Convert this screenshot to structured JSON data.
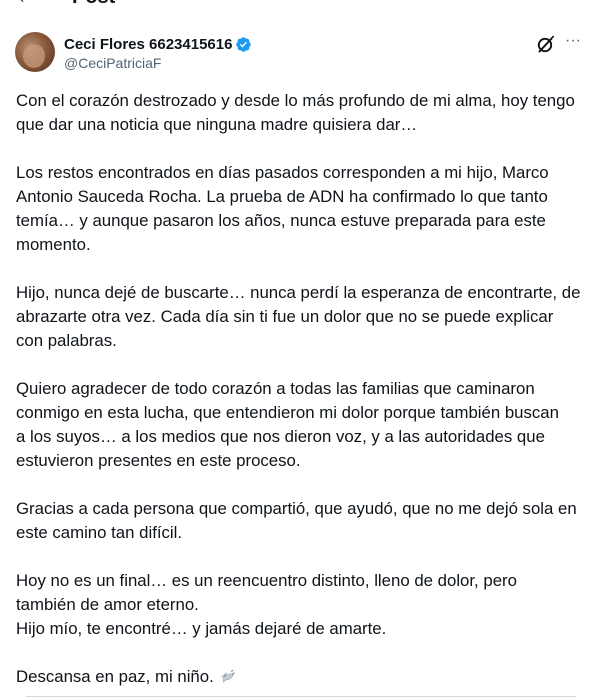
{
  "topbar": {
    "back_glyph": "←",
    "title": "Post"
  },
  "author": {
    "display_name": "Ceci Flores 6623415616",
    "handle": "@CeciPatriciaF",
    "verified": true,
    "badge_color": "#1d9bf0"
  },
  "actions": {
    "grok_icon": "grok-icon",
    "more_icon": "more-icon",
    "more_glyph": "···"
  },
  "tweet": {
    "paragraphs": [
      {
        "lines": [
          "Con el corazón destrozado y desde lo más profundo de mi alma, hoy tengo",
          "que dar una noticia que ninguna madre quisiera dar…"
        ]
      },
      {
        "lines": [
          "Los restos encontrados en días pasados corresponden a mi hijo, Marco",
          "Antonio Sauceda Rocha. La prueba de ADN ha confirmado lo que tanto",
          "temía… y aunque pasaron los años, nunca estuve preparada para este",
          "momento."
        ]
      },
      {
        "lines": [
          "Hijo, nunca dejé de buscarte… nunca perdí la esperanza de encontrarte, de",
          "abrazarte otra vez. Cada día sin ti fue un dolor que no se puede explicar",
          "con palabras."
        ]
      },
      {
        "lines": [
          "Quiero agradecer de todo corazón a todas las familias que caminaron",
          "conmigo en esta lucha, que entendieron mi dolor porque también buscan",
          "a los suyos… a los medios que nos dieron voz, y a las autoridades que",
          "estuvieron presentes en este proceso."
        ]
      },
      {
        "lines": [
          "Gracias a cada persona que compartió, que ayudó, que no me dejó sola en",
          "este camino tan difícil."
        ]
      },
      {
        "lines": [
          "Hoy no es un final… es un reencuentro distinto, lleno de dolor, pero",
          "también de amor eterno.",
          "Hijo mío, te encontré… y jamás dejaré de amarte."
        ]
      },
      {
        "lines": [
          "Descansa en paz, mi niño."
        ],
        "trailing_icon": "dove-icon"
      }
    ]
  },
  "colors": {
    "text": "#0f1419",
    "secondary_text": "#536471",
    "divider": "#cfd9de"
  }
}
